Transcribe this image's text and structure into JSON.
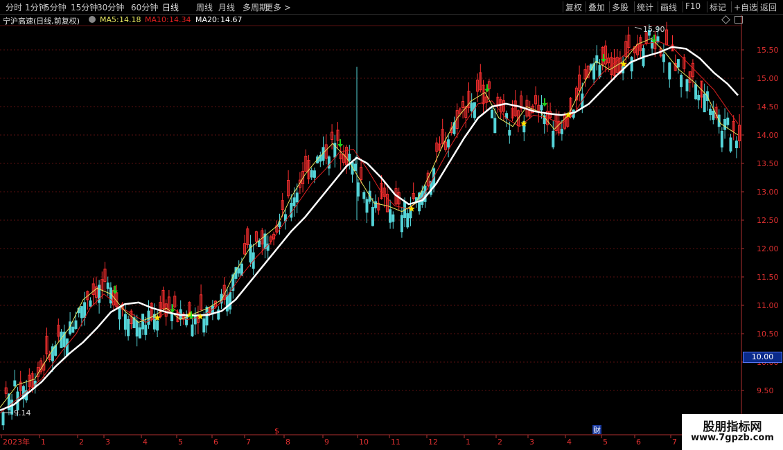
{
  "toolbar": {
    "left": [
      "分时",
      "1分钟",
      "5分钟",
      "15分钟",
      "30分钟",
      "60分钟",
      "日线",
      "周线",
      "月线",
      "多周期",
      "更多 >"
    ],
    "active": "日线",
    "right": [
      "复权",
      "叠加",
      "多股",
      "统计",
      "画线",
      "F10",
      "标记",
      "+自选",
      "返回"
    ]
  },
  "info": {
    "title": "宁沪高速(日线,前复权)",
    "ma5_label": "MA5:",
    "ma5_value": "14.18",
    "ma10_label": "MA10:",
    "ma10_value": "14.34",
    "ma20_label": "MA20:",
    "ma20_value": "14.67",
    "icons": [
      "settings-circle-icon",
      "diamond-icon",
      "window-icon"
    ]
  },
  "colors": {
    "up": "#ff3030",
    "down": "#54d4d8",
    "ma5": "#e8e860",
    "ma10": "#e02020",
    "ma20": "#ffffff",
    "grid": "#5a1010",
    "axis": "#b03030",
    "buy_star": "#ffe000",
    "sell_arrow": "#20d020"
  },
  "chart_data": {
    "type": "candlestick",
    "title": "宁沪高速(日线,前复权)",
    "y_ticks": [
      "9.50",
      "10.00",
      "10.50",
      "11.00",
      "11.50",
      "12.00",
      "12.50",
      "13.00",
      "13.50",
      "14.00",
      "14.50",
      "15.00",
      "15.50"
    ],
    "ylim": [
      9.0,
      15.9
    ],
    "x_ticks": [
      "2023年",
      "1",
      "2",
      "3",
      "4",
      "5",
      "6",
      "7",
      "8",
      "9",
      "10",
      "11",
      "12",
      "1",
      "2",
      "3",
      "4",
      "5",
      "6",
      "7"
    ],
    "high_label": "15.90",
    "low_label": "9.14",
    "current_price": "10.00",
    "markers": [
      "$",
      "财"
    ],
    "ma20_path": [
      [
        0,
        9.15
      ],
      [
        20,
        9.25
      ],
      [
        40,
        9.45
      ],
      [
        60,
        9.65
      ],
      [
        80,
        9.92
      ],
      [
        100,
        10.15
      ],
      [
        120,
        10.35
      ],
      [
        140,
        10.6
      ],
      [
        160,
        10.88
      ],
      [
        180,
        11.02
      ],
      [
        200,
        11.05
      ],
      [
        220,
        10.95
      ],
      [
        240,
        10.88
      ],
      [
        260,
        10.83
      ],
      [
        280,
        10.82
      ],
      [
        300,
        10.83
      ],
      [
        320,
        10.9
      ],
      [
        340,
        11.1
      ],
      [
        360,
        11.4
      ],
      [
        380,
        11.7
      ],
      [
        400,
        12.0
      ],
      [
        420,
        12.3
      ],
      [
        440,
        12.55
      ],
      [
        460,
        12.85
      ],
      [
        480,
        13.15
      ],
      [
        500,
        13.45
      ],
      [
        515,
        13.6
      ],
      [
        530,
        13.5
      ],
      [
        550,
        13.25
      ],
      [
        570,
        12.95
      ],
      [
        590,
        12.78
      ],
      [
        610,
        12.85
      ],
      [
        630,
        13.15
      ],
      [
        650,
        13.55
      ],
      [
        670,
        13.95
      ],
      [
        690,
        14.3
      ],
      [
        710,
        14.5
      ],
      [
        730,
        14.55
      ],
      [
        750,
        14.5
      ],
      [
        770,
        14.42
      ],
      [
        790,
        14.38
      ],
      [
        810,
        14.35
      ],
      [
        830,
        14.4
      ],
      [
        850,
        14.55
      ],
      [
        870,
        14.8
      ],
      [
        890,
        15.05
      ],
      [
        910,
        15.28
      ],
      [
        930,
        15.38
      ],
      [
        950,
        15.45
      ],
      [
        970,
        15.55
      ],
      [
        990,
        15.52
      ],
      [
        1010,
        15.35
      ],
      [
        1030,
        15.1
      ],
      [
        1050,
        14.9
      ],
      [
        1065,
        14.7
      ]
    ],
    "ma10_path": [
      [
        0,
        9.1
      ],
      [
        30,
        9.4
      ],
      [
        60,
        9.7
      ],
      [
        90,
        10.2
      ],
      [
        110,
        10.5
      ],
      [
        130,
        10.95
      ],
      [
        150,
        11.2
      ],
      [
        170,
        11.0
      ],
      [
        190,
        10.85
      ],
      [
        210,
        10.7
      ],
      [
        230,
        10.8
      ],
      [
        250,
        10.95
      ],
      [
        270,
        10.75
      ],
      [
        290,
        10.8
      ],
      [
        310,
        10.95
      ],
      [
        330,
        11.2
      ],
      [
        350,
        11.55
      ],
      [
        370,
        11.85
      ],
      [
        390,
        12.1
      ],
      [
        410,
        12.45
      ],
      [
        430,
        12.8
      ],
      [
        450,
        13.15
      ],
      [
        470,
        13.4
      ],
      [
        490,
        13.7
      ],
      [
        510,
        13.75
      ],
      [
        530,
        13.4
      ],
      [
        550,
        13.0
      ],
      [
        570,
        12.75
      ],
      [
        590,
        12.7
      ],
      [
        610,
        12.9
      ],
      [
        630,
        13.35
      ],
      [
        650,
        13.8
      ],
      [
        670,
        14.2
      ],
      [
        690,
        14.55
      ],
      [
        710,
        14.6
      ],
      [
        730,
        14.3
      ],
      [
        750,
        14.15
      ],
      [
        770,
        14.35
      ],
      [
        790,
        14.3
      ],
      [
        810,
        14.2
      ],
      [
        830,
        14.4
      ],
      [
        850,
        14.8
      ],
      [
        870,
        15.1
      ],
      [
        890,
        15.3
      ],
      [
        910,
        15.5
      ],
      [
        930,
        15.6
      ],
      [
        950,
        15.65
      ],
      [
        970,
        15.55
      ],
      [
        990,
        15.3
      ],
      [
        1010,
        15.05
      ],
      [
        1030,
        14.8
      ],
      [
        1050,
        14.45
      ],
      [
        1065,
        14.2
      ]
    ],
    "ma5_path": [
      [
        0,
        9.2
      ],
      [
        25,
        9.6
      ],
      [
        50,
        9.7
      ],
      [
        75,
        10.2
      ],
      [
        100,
        10.6
      ],
      [
        120,
        11.1
      ],
      [
        140,
        11.3
      ],
      [
        160,
        11.2
      ],
      [
        180,
        10.9
      ],
      [
        200,
        10.7
      ],
      [
        220,
        10.8
      ],
      [
        240,
        10.95
      ],
      [
        260,
        10.75
      ],
      [
        280,
        10.85
      ],
      [
        300,
        10.95
      ],
      [
        320,
        11.1
      ],
      [
        340,
        11.6
      ],
      [
        360,
        12.0
      ],
      [
        380,
        12.2
      ],
      [
        400,
        12.4
      ],
      [
        420,
        12.9
      ],
      [
        440,
        13.3
      ],
      [
        460,
        13.6
      ],
      [
        480,
        13.85
      ],
      [
        500,
        13.6
      ],
      [
        520,
        13.2
      ],
      [
        540,
        12.8
      ],
      [
        560,
        12.75
      ],
      [
        580,
        12.65
      ],
      [
        600,
        12.8
      ],
      [
        620,
        13.3
      ],
      [
        640,
        13.85
      ],
      [
        660,
        14.3
      ],
      [
        680,
        14.6
      ],
      [
        700,
        14.75
      ],
      [
        720,
        14.3
      ],
      [
        740,
        14.15
      ],
      [
        760,
        14.5
      ],
      [
        780,
        14.4
      ],
      [
        800,
        14.1
      ],
      [
        820,
        14.35
      ],
      [
        840,
        14.85
      ],
      [
        860,
        15.3
      ],
      [
        880,
        15.15
      ],
      [
        900,
        15.3
      ],
      [
        920,
        15.6
      ],
      [
        940,
        15.7
      ],
      [
        960,
        15.45
      ],
      [
        980,
        15.15
      ],
      [
        1000,
        14.95
      ],
      [
        1020,
        14.7
      ],
      [
        1040,
        14.2
      ],
      [
        1065,
        14.0
      ]
    ],
    "buy_signals": [
      [
        227,
        10.78
      ],
      [
        274,
        10.83
      ],
      [
        289,
        10.8
      ],
      [
        594,
        12.7
      ],
      [
        756,
        14.2
      ],
      [
        820,
        14.35
      ],
      [
        900,
        15.25
      ]
    ],
    "sell_signals": [
      [
        166,
        11.2
      ],
      [
        249,
        10.87
      ],
      [
        276,
        10.75
      ],
      [
        491,
        13.78
      ],
      [
        703,
        14.75
      ],
      [
        786,
        14.5
      ],
      [
        871,
        15.28
      ],
      [
        944,
        15.62
      ]
    ]
  }
}
